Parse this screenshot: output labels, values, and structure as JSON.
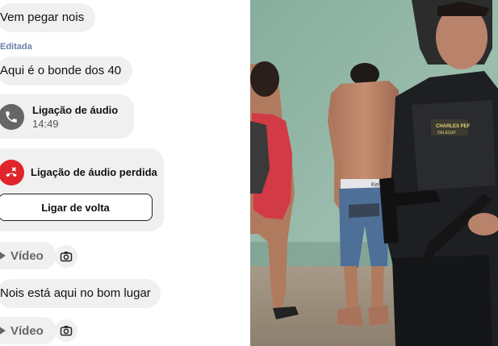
{
  "chat": {
    "messages": [
      {
        "text": "Vem pegar nois"
      },
      {
        "edited_label": "Editada",
        "text": "Aqui é o bonde dos 40"
      },
      {
        "call_title": "Ligação de áudio",
        "call_time": "14:49",
        "icon": "phone-icon"
      },
      {
        "call_title": "Ligação de áudio perdida",
        "icon": "missed-call-icon",
        "callback_label": "Ligar de volta"
      },
      {
        "video_label": "Vídeo",
        "icon": "play-icon",
        "action_icon": "camera-icon"
      },
      {
        "text": "Nois está aqui no bom lugar"
      },
      {
        "video_label": "Vídeo",
        "icon": "play-icon",
        "action_icon": "camera-icon"
      }
    ]
  },
  "photo": {
    "vest_tag_name": "CHARLES PEF",
    "vest_tag_role": "DELEGAT",
    "waistband_text": "Kel"
  },
  "colors": {
    "bubble": "#f0f0f1",
    "missed_call_red": "#e0242b",
    "edited_label": "#6b7fa8",
    "wall_green": "#8fb4a4"
  }
}
